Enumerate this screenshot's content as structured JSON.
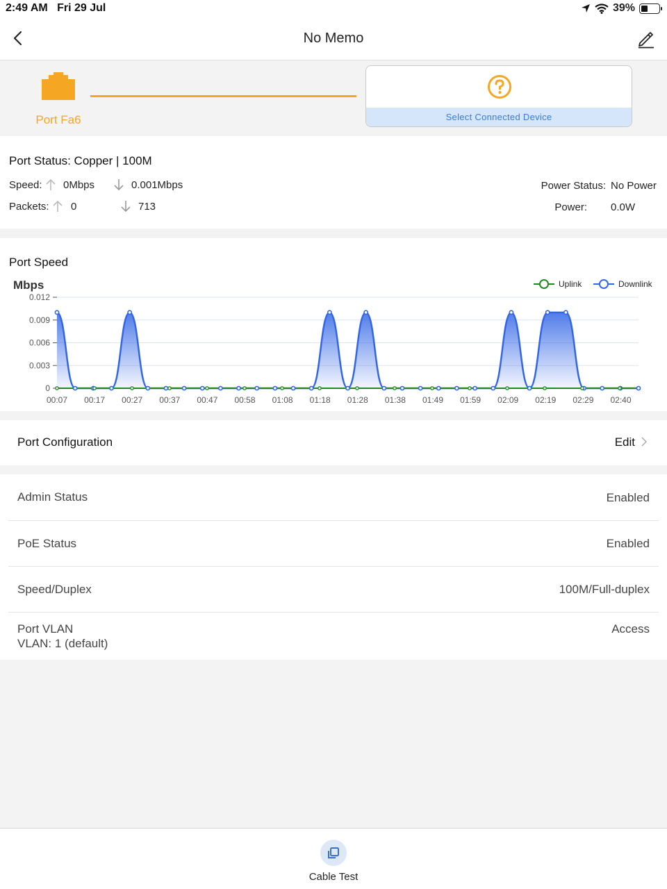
{
  "status_bar": {
    "time": "2:49 AM",
    "date": "Fri 29 Jul",
    "battery": "39%",
    "battery_level": 0.39
  },
  "nav": {
    "title": "No Memo",
    "back_icon": "chevron-left-icon",
    "edit_icon": "pencil-icon"
  },
  "port_banner": {
    "port_label": "Port Fa6",
    "device_placeholder": "Select Connected Device",
    "accent": "#f5a623"
  },
  "port_info": {
    "title": "Port Status: Copper | 100M",
    "speed_label": "Speed:",
    "speed_up": "0Mbps",
    "speed_down": "0.001Mbps",
    "packets_label": "Packets:",
    "packets_up": "0",
    "packets_down": "713",
    "power_status_label": "Power Status:",
    "power_status_value": "No Power",
    "power_label": "Power:",
    "power_value": "0.0W"
  },
  "port_speed": {
    "heading": "Port Speed",
    "chart_data": {
      "type": "line",
      "ylabel": "Mbps",
      "ylim": [
        0,
        0.012
      ],
      "yticks": [
        "0.012",
        "0.009",
        "0.006",
        "0.003",
        "0"
      ],
      "xticks": [
        "00:07",
        "00:17",
        "00:27",
        "00:37",
        "00:47",
        "00:58",
        "01:08",
        "01:18",
        "01:28",
        "01:38",
        "01:49",
        "01:59",
        "02:09",
        "02:19",
        "02:29",
        "02:40"
      ],
      "legend_position": "top-right",
      "grid": true,
      "series": [
        {
          "name": "Uplink",
          "color": "#1e8a1e",
          "values": [
            0,
            0,
            0,
            0,
            0,
            0,
            0,
            0,
            0,
            0,
            0,
            0,
            0,
            0,
            0,
            0,
            0,
            0,
            0,
            0,
            0,
            0,
            0,
            0,
            0,
            0,
            0,
            0,
            0,
            0,
            0,
            0
          ]
        },
        {
          "name": "Downlink",
          "color": "#3366e6",
          "values": [
            0.01,
            0,
            0,
            0,
            0.01,
            0,
            0,
            0,
            0,
            0,
            0,
            0,
            0,
            0,
            0,
            0.01,
            0,
            0.01,
            0,
            0,
            0,
            0,
            0,
            0,
            0,
            0.01,
            0,
            0.01,
            0.01,
            0,
            0,
            0,
            0
          ]
        }
      ]
    }
  },
  "config": {
    "label": "Port Configuration",
    "edit": "Edit"
  },
  "details": [
    {
      "key": "Admin Status",
      "value": "Enabled"
    },
    {
      "key": "PoE Status",
      "value": "Enabled"
    },
    {
      "key": "Speed/Duplex",
      "value": "100M/Full-duplex"
    },
    {
      "key": "Port VLAN",
      "value": "Access",
      "sub": "VLAN: 1 (default)"
    }
  ],
  "bottom": {
    "cable_test": "Cable Test",
    "cable_icon": "copy-icon"
  }
}
